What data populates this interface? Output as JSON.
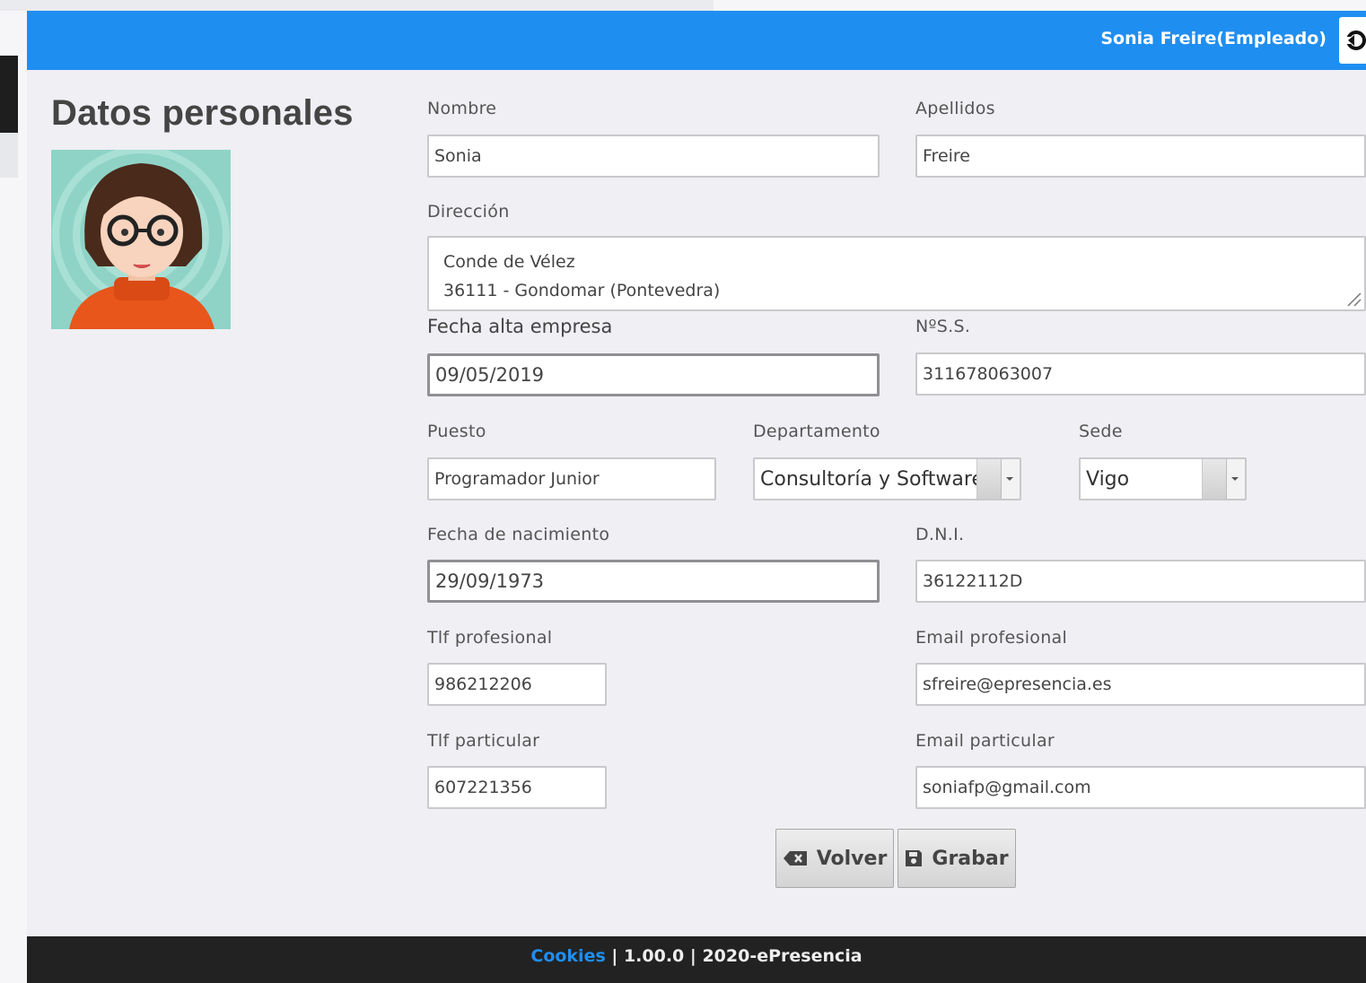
{
  "header": {
    "user_label": "Sonia Freire(Empleado)"
  },
  "page": {
    "title": "Datos personales"
  },
  "form": {
    "nombre": {
      "label": "Nombre",
      "value": "Sonia"
    },
    "apellidos": {
      "label": "Apellidos",
      "value": "Freire"
    },
    "direccion": {
      "label": "Dirección",
      "line1": "Conde de Vélez",
      "line2": "36111 - Gondomar (Pontevedra)"
    },
    "fecha_alta": {
      "label": "Fecha alta empresa",
      "value": "09/05/2019"
    },
    "nss": {
      "label": "NºS.S.",
      "value": "311678063007"
    },
    "puesto": {
      "label": "Puesto",
      "value": "Programador Junior"
    },
    "departamento": {
      "label": "Departamento",
      "value": "Consultoría y Software"
    },
    "sede": {
      "label": "Sede",
      "value": "Vigo"
    },
    "fecha_nacimiento": {
      "label": "Fecha de nacimiento",
      "value": "29/09/1973"
    },
    "dni": {
      "label": "D.N.I.",
      "value": "36122112D"
    },
    "tlf_profesional": {
      "label": "Tlf profesional",
      "value": "986212206"
    },
    "email_profesional": {
      "label": "Email profesional",
      "value": "sfreire@epresencia.es"
    },
    "tlf_particular": {
      "label": "Tlf particular",
      "value": "607221356"
    },
    "email_particular": {
      "label": "Email particular",
      "value": "soniafp@gmail.com"
    }
  },
  "actions": {
    "volver": "Volver",
    "grabar": "Grabar"
  },
  "footer": {
    "cookies": "Cookies",
    "text": "| 1.00.0 | 2020-ePresencia"
  },
  "colors": {
    "topbar": "#1f8ef1",
    "footer": "#222222",
    "page_bg": "#efeff4"
  },
  "icons": [
    "logout-icon",
    "backspace-icon",
    "save-icon",
    "resize-grip-icon",
    "chevron-down-icon"
  ]
}
